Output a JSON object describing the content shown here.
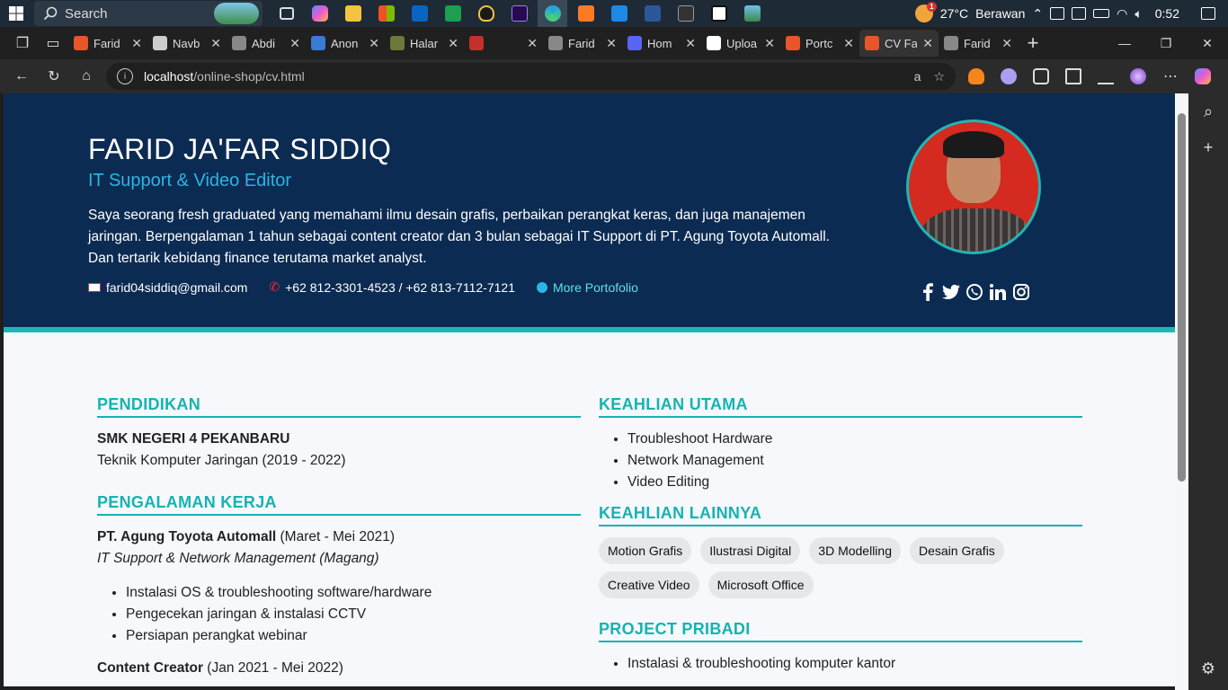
{
  "taskbar": {
    "search_label": "Search",
    "weather_temp": "27°C",
    "weather_desc": "Berawan",
    "time": "0:52",
    "weather_badge": "1"
  },
  "tabs": [
    {
      "label": "Farid",
      "color": "#e8552b"
    },
    {
      "label": "Navb",
      "color": "#cccccc"
    },
    {
      "label": "Abdi",
      "color": "#888888"
    },
    {
      "label": "Anon",
      "color": "#3a7bd5"
    },
    {
      "label": "Halar",
      "color": "#6b7a3a"
    },
    {
      "label": "",
      "color": "#c4302b"
    },
    {
      "label": "Farid",
      "color": "#888888"
    },
    {
      "label": "Hom",
      "color": "#5865f2"
    },
    {
      "label": "Uploa",
      "color": "#ffffff"
    },
    {
      "label": "Portc",
      "color": "#e8552b"
    },
    {
      "label": "CV Fa",
      "color": "#e8552b"
    },
    {
      "label": "Farid",
      "color": "#888888"
    }
  ],
  "url": {
    "host": "localhost",
    "path": "/online-shop/cv.html"
  },
  "cv": {
    "name": "FARID JA'FAR SIDDIQ",
    "role": "IT Support & Video Editor",
    "bio": "Saya seorang fresh graduated yang memahami ilmu desain grafis, perbaikan perangkat keras, dan juga manajemen jaringan. Berpengalaman 1 tahun sebagai content creator dan 3 bulan sebagai IT Support di PT. Agung Toyota Automall. Dan tertarik kebidang finance terutama market analyst.",
    "email": "farid04siddiq@gmail.com",
    "phone": "+62 812-3301-4523 / +62 813-7112-7121",
    "portfolio_link": "More Portofolio"
  },
  "sections": {
    "education_title": "PENDIDIKAN",
    "education_school": "SMK NEGERI 4 PEKANBARU",
    "education_major": "Teknik Komputer Jaringan (2019 - 2022)",
    "experience_title": "PENGALAMAN KERJA",
    "job1_company": "PT. Agung Toyota Automall",
    "job1_period": " (Maret - Mei 2021)",
    "job1_role": "IT Support & Network Management (Magang)",
    "job1_tasks": [
      "Instalasi OS & troubleshooting software/hardware",
      "Pengecekan jaringan & instalasi CCTV",
      "Persiapan perangkat webinar"
    ],
    "job2_title": "Content Creator",
    "job2_period": " (Jan 2021 - Mei 2022)",
    "main_skills_title": "KEAHLIAN UTAMA",
    "main_skills": [
      "Troubleshoot Hardware",
      "Network Management",
      "Video Editing"
    ],
    "other_skills_title": "KEAHLIAN LAINNYA",
    "other_skills": [
      "Motion Grafis",
      "Ilustrasi Digital",
      "3D Modelling",
      "Desain Grafis",
      "Creative Video",
      "Microsoft Office"
    ],
    "projects_title": "PROJECT PRIBADI",
    "projects": [
      "Instalasi & troubleshooting komputer kantor"
    ]
  }
}
